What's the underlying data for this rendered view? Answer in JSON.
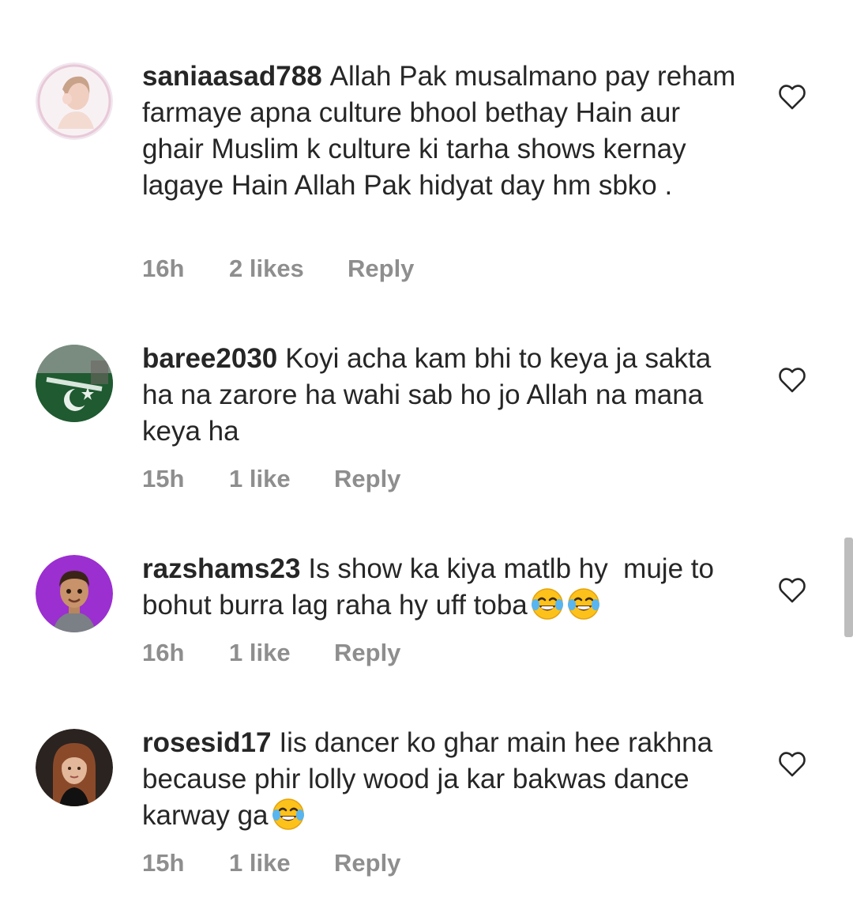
{
  "comments": [
    {
      "username": "saniaasad788",
      "text": "Allah Pak musalmano pay reham farmaye apna culture bhool bethay Hain aur ghair Muslim k culture ki tarha shows kernay lagaye Hain Allah Pak hidyat day hm sbko .",
      "emoji_count": 0,
      "time": "16h",
      "likes": "2 likes",
      "reply": "Reply"
    },
    {
      "username": "baree2030",
      "text": "Koyi acha kam bhi to keya ja sakta ha na zarore ha wahi sab ho jo Allah na mana keya ha",
      "emoji_count": 0,
      "time": "15h",
      "likes": "1 like",
      "reply": "Reply"
    },
    {
      "username": "razshams23",
      "text": "Is show ka kiya matlb hy  muje to bohut burra lag raha hy uff toba",
      "emoji_count": 2,
      "time": "16h",
      "likes": "1 like",
      "reply": "Reply"
    },
    {
      "username": "rosesid17",
      "text": "Iis dancer ko ghar main hee rakhna because phir lolly wood ja kar bakwas dance karway ga",
      "emoji_count": 1,
      "time": "15h",
      "likes": "1 like",
      "reply": "Reply"
    }
  ],
  "icons": {
    "like": "heart-outline-icon",
    "emoji": "face-with-tears-of-joy-emoji"
  },
  "colors": {
    "text": "#262626",
    "meta": "#8e8e8e",
    "heart_stroke": "#262626",
    "background": "#ffffff"
  }
}
